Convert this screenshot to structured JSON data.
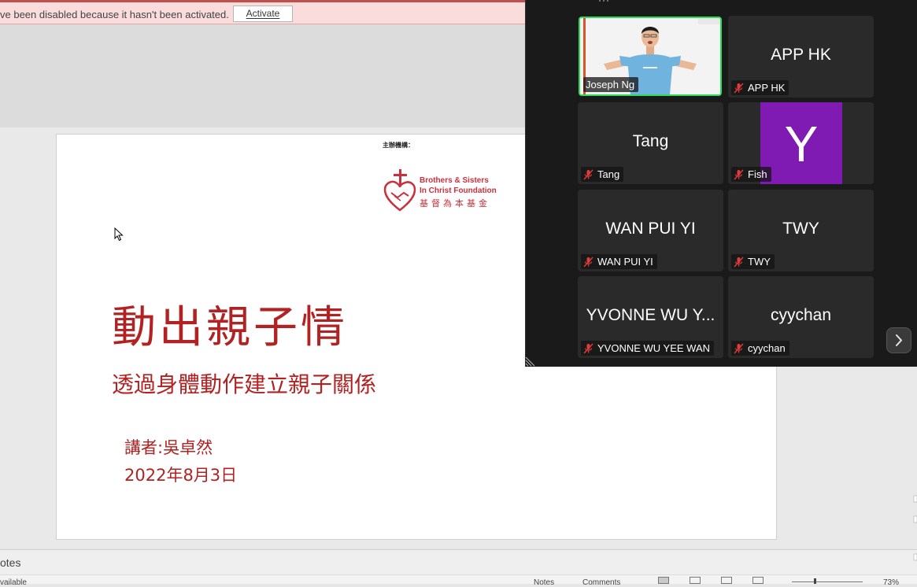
{
  "activation_bar": {
    "message": "ve been disabled because it hasn't been activated.",
    "activate_label": "Activate"
  },
  "slide": {
    "organizer_label": "主辦機構：",
    "logo_name_line1": "Brothers & Sisters",
    "logo_name_line2": "In Christ Foundation",
    "logo_chinese": "基督為本基金",
    "title": "動出親子情",
    "subtitle": "透過身體動作建立親子關係",
    "speaker": "講者:吳卓然",
    "date": "2022年8月3日"
  },
  "notes_pane": {
    "label": "otes"
  },
  "status_bar": {
    "accessibility": "vailable",
    "notes_label": "Notes",
    "comments_label": "Comments",
    "zoom_level": "73%"
  },
  "zoom_gallery": {
    "participants": [
      {
        "id": "joseph",
        "display_name": "",
        "label": "Joseph Ng",
        "video_on": true,
        "muted": false,
        "active_speaker": true
      },
      {
        "id": "apphk",
        "display_name": "APP HK",
        "label": "APP HK",
        "muted": true
      },
      {
        "id": "tang",
        "display_name": "Tang",
        "label": "Tang",
        "muted": true
      },
      {
        "id": "fish",
        "display_name": "Y",
        "label": "Fish",
        "muted": true,
        "avatar_color": "#7f1bb3"
      },
      {
        "id": "wanpuiyi",
        "display_name": "WAN PUI YI",
        "label": "WAN PUI YI",
        "muted": true
      },
      {
        "id": "twy",
        "display_name": "TWY",
        "label": "TWY",
        "muted": true
      },
      {
        "id": "yvonne",
        "display_name": "YVONNE WU Y...",
        "label": "YVONNE WU YEE WAN",
        "muted": true
      },
      {
        "id": "cyychan",
        "display_name": "cyychan",
        "label": "cyychan",
        "muted": true
      }
    ],
    "active_speaker_color": "#2bdc5b",
    "muted_icon_color": "#e23b3b"
  },
  "colors": {
    "slide_text": "#b22222",
    "logo_red": "#c8323c",
    "activation_bar_bg": "#fadcdc"
  }
}
